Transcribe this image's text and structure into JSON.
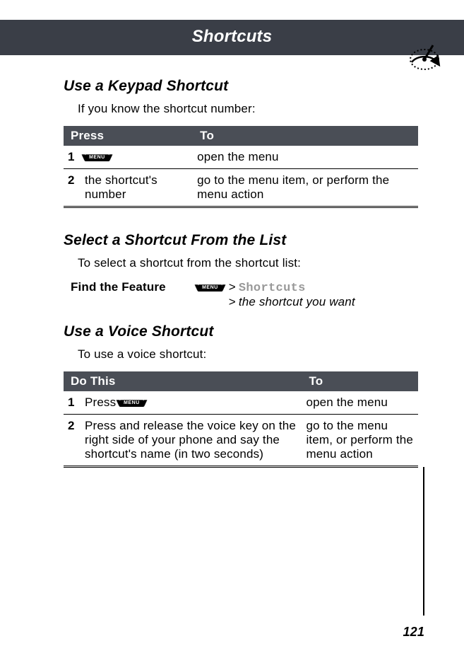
{
  "header": {
    "title": "Shortcuts"
  },
  "section1": {
    "heading": "Use a Keypad Shortcut",
    "intro": "If you know the shortcut number:",
    "table": {
      "col1": "Press",
      "col2": "To",
      "rows": [
        {
          "n": "1",
          "press": "",
          "to": "open the menu"
        },
        {
          "n": "2",
          "press": "the shortcut's number",
          "to": "go to the menu item, or perform the menu action"
        }
      ]
    }
  },
  "section2": {
    "heading": "Select a Shortcut From the List",
    "intro": "To select a shortcut from the shortcut list:",
    "feature_label": "Find the Feature",
    "path_item": "Shortcuts",
    "path_desc": "the shortcut you want",
    "gt": ">"
  },
  "section3": {
    "heading": "Use a Voice Shortcut",
    "intro": "To use a voice shortcut:",
    "table": {
      "col1": "Do This",
      "col2": "To",
      "rows": [
        {
          "n": "1",
          "do_prefix": "Press ",
          "to": "open the menu"
        },
        {
          "n": "2",
          "do": "Press and release the voice key on the right side of your phone and say the shortcut's name (in two seconds)",
          "to": "go to the menu item, or perform the menu action"
        }
      ]
    }
  },
  "menu_key_label": "MENU",
  "page_number": "121"
}
